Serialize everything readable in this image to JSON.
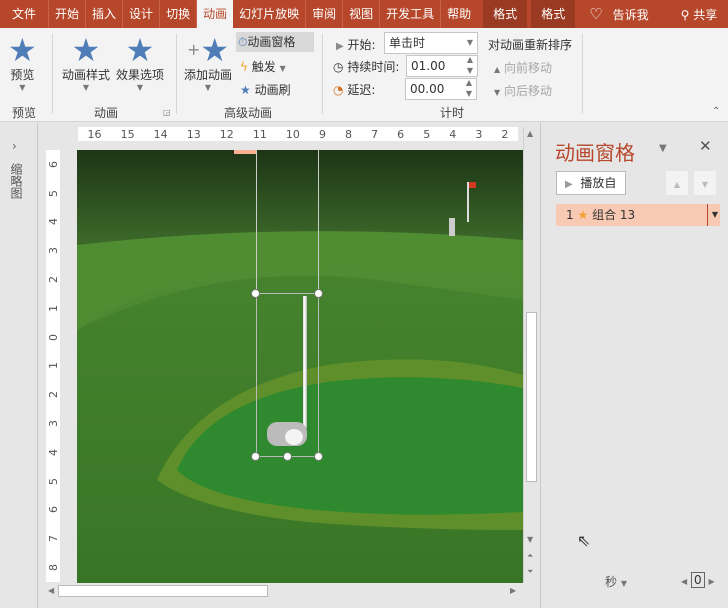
{
  "tabs": [
    "文件",
    "开始",
    "插入",
    "设计",
    "切换",
    "动画",
    "幻灯片放映",
    "审阅",
    "视图",
    "开发工具",
    "帮助"
  ],
  "context_tabs": [
    "格式",
    "格式"
  ],
  "tell_me": "告诉我",
  "share": "共享",
  "ribbon": {
    "preview": {
      "label": "预览",
      "group": "预览"
    },
    "animation_styles": "动画样式",
    "effect_options": "效果选项",
    "animation_group": "动画",
    "add_animation": "添加动画",
    "animation_pane": "动画窗格",
    "trigger": "触发",
    "animation_painter": "动画刷",
    "advanced_group": "高级动画",
    "start_label": "开始:",
    "start_value": "单击时",
    "duration_label": "持续时间:",
    "duration_value": "01.00",
    "delay_label": "延迟:",
    "delay_value": "00.00",
    "reorder_title": "对动画重新排序",
    "move_earlier": "向前移动",
    "move_later": "向后移动",
    "timing_group": "计时"
  },
  "thumbnails_label": "缩略图",
  "hruler": [
    "16",
    "15",
    "14",
    "13",
    "12",
    "11",
    "10",
    "9",
    "8",
    "7",
    "6",
    "5",
    "4",
    "3",
    "2"
  ],
  "vruler": [
    "6",
    "5",
    "4",
    "3",
    "2",
    "1",
    "0",
    "1",
    "2",
    "3",
    "4",
    "5",
    "6",
    "7",
    "8"
  ],
  "pane": {
    "title": "动画窗格",
    "play_from": "播放自",
    "items": [
      {
        "index": "1",
        "name": "组合 13"
      }
    ],
    "time_unit": "秒",
    "zoom_value": "0"
  },
  "colors": {
    "accent": "#b7472a",
    "item_bg": "#f8c9b3",
    "star": "#4f7db8"
  }
}
